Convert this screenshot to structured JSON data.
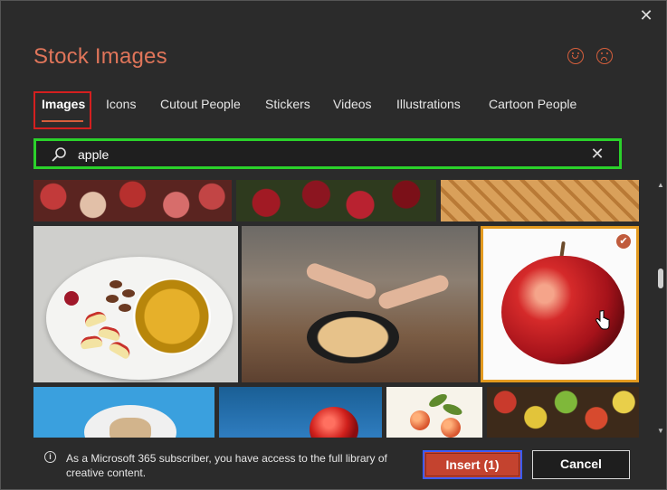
{
  "dialog": {
    "title": "Stock Images",
    "close_glyph": "✕"
  },
  "feedback": {
    "happy_icon": "smiley-happy-icon",
    "sad_icon": "smiley-sad-icon"
  },
  "tabs": [
    {
      "label": "Images",
      "active": true
    },
    {
      "label": "Icons",
      "active": false
    },
    {
      "label": "Cutout People",
      "active": false
    },
    {
      "label": "Stickers",
      "active": false
    },
    {
      "label": "Videos",
      "active": false
    },
    {
      "label": "Illustrations",
      "active": false
    },
    {
      "label": "Cartoon People",
      "active": false
    }
  ],
  "search": {
    "value": "apple",
    "clear_glyph": "✕"
  },
  "results": {
    "selected_check_glyph": "✔"
  },
  "footer": {
    "info_glyph": "i",
    "message": "As a Microsoft 365 subscriber, you have access to the full library of creative content.",
    "insert_label": "Insert (1)",
    "cancel_label": "Cancel"
  },
  "scrollbar": {
    "up_glyph": "▲",
    "down_glyph": "▼"
  },
  "colors": {
    "accent": "#c4432f",
    "title": "#e0755a",
    "tab_highlight": "#d41f1f",
    "search_highlight": "#2bd12b",
    "selected_border": "#e39a1f",
    "insert_focus": "#3b5cff"
  }
}
